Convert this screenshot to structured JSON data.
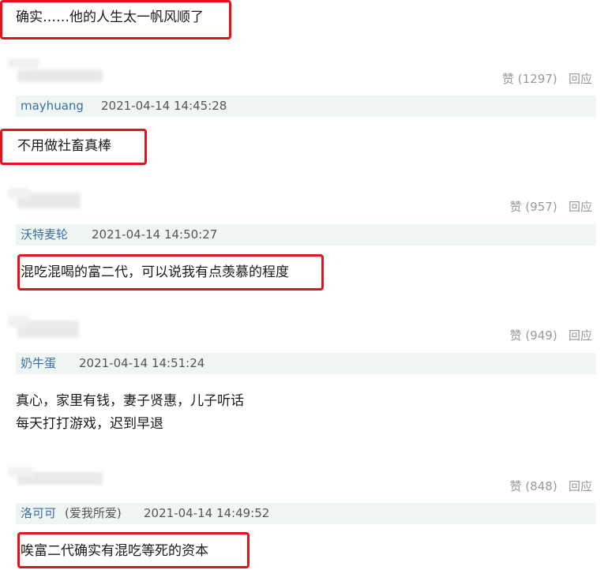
{
  "top_comment": {
    "text": "确实……他的人生太一帆风顺了"
  },
  "comments": [
    {
      "likes": "赞 (1297)",
      "reply": "回应",
      "username": "mayhuang",
      "username_suffix": "",
      "timestamp": "2021-04-14 14:45:28",
      "text_lines": [
        "不用做社畜真棒"
      ]
    },
    {
      "likes": "赞 (957)",
      "reply": "回应",
      "username": "沃特麦轮",
      "username_suffix": "",
      "timestamp": "2021-04-14 14:50:27",
      "text_lines": [
        "混吃混喝的富二代，可以说我有点羡慕的程度"
      ]
    },
    {
      "likes": "赞 (949)",
      "reply": "回应",
      "username": "奶牛蛋",
      "username_suffix": "",
      "timestamp": "2021-04-14 14:51:24",
      "text_lines": [
        "真心，家里有钱，妻子贤惠，儿子听话",
        "每天打打游戏，迟到早退"
      ]
    },
    {
      "likes": "赞 (848)",
      "reply": "回应",
      "username": "洛可可",
      "username_suffix": "(爱我所爱)",
      "timestamp": "2021-04-14 14:49:52",
      "text_lines": [
        "唉富二代确实有混吃等死的资本"
      ]
    }
  ],
  "colors": {
    "highlight": "#e4131b",
    "username": "#3a6ea5",
    "meta_bg": "#eff5f2"
  }
}
